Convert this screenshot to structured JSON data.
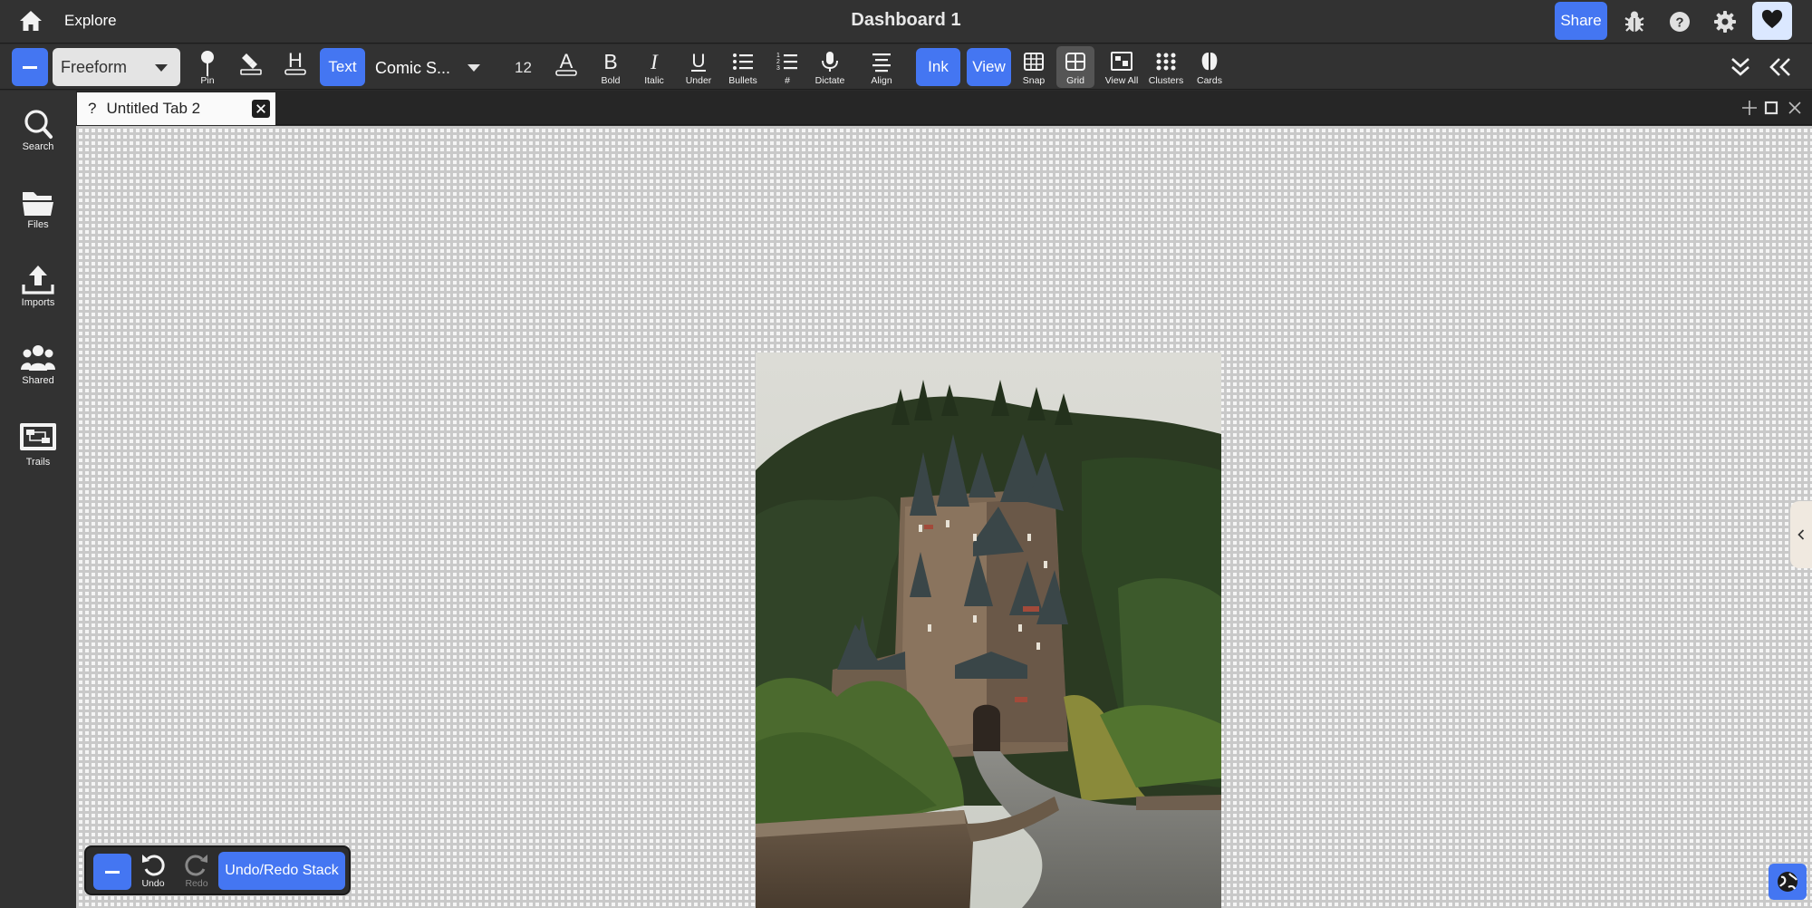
{
  "topbar": {
    "home_icon": "home-icon",
    "explore_label": "Explore",
    "dashboard_title": "Dashboard 1",
    "share_label": "Share",
    "icons": [
      "bug-icon",
      "help-icon",
      "gear-icon",
      "heart-icon"
    ]
  },
  "toolbar": {
    "mode_value": "Freeform",
    "pin_label": "Pin",
    "text_button_label": "Text",
    "font_family_value": "Comic S...",
    "font_size_value": "12",
    "bold_label": "Bold",
    "italic_label": "Italic",
    "underline_label": "Under",
    "bullets_label": "Bullets",
    "numbered_label": "#",
    "dictate_label": "Dictate",
    "align_label": "Align",
    "ink_label": "Ink",
    "view_label": "View",
    "snap_label": "Snap",
    "grid_label": "Grid",
    "view_all_label": "View All",
    "clusters_label": "Clusters",
    "cards_label": "Cards"
  },
  "sidebar": {
    "items": [
      {
        "label": "Search",
        "icon": "search-icon"
      },
      {
        "label": "Files",
        "icon": "folder-icon"
      },
      {
        "label": "Imports",
        "icon": "upload-icon"
      },
      {
        "label": "Shared",
        "icon": "users-icon"
      },
      {
        "label": "Trails",
        "icon": "trails-icon"
      }
    ]
  },
  "tabs": {
    "active": {
      "marker": "?",
      "title": "Untitled Tab 2"
    }
  },
  "canvas": {
    "image_subject": "castle-photo"
  },
  "undo_panel": {
    "undo_label": "Undo",
    "redo_label": "Redo",
    "stack_label": "Undo/Redo Stack"
  },
  "colors": {
    "accent": "#4476f2",
    "chrome": "#323232",
    "canvas": "#f5f5f5"
  }
}
